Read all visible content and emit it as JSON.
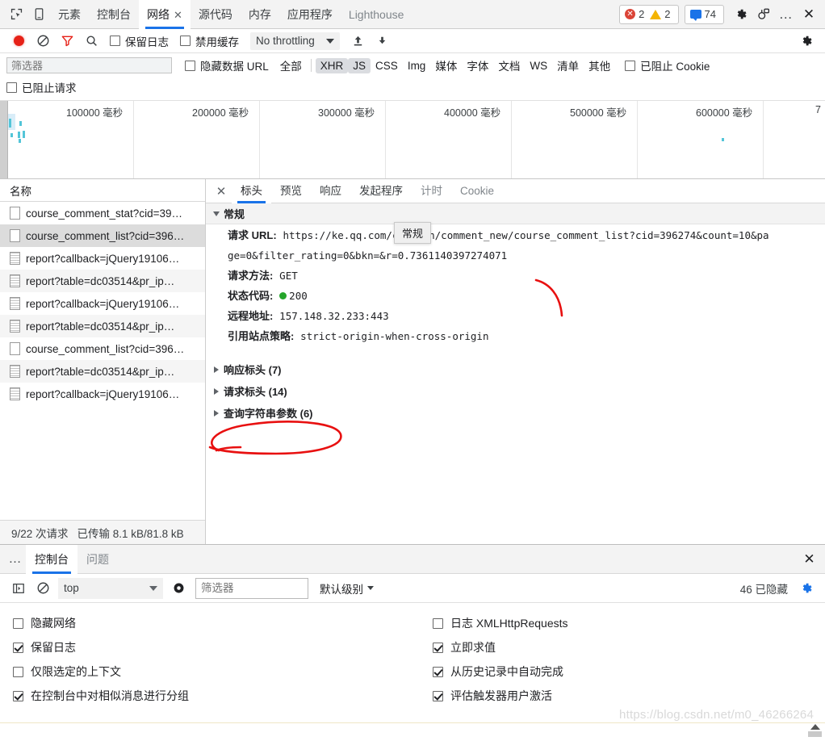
{
  "topbar": {
    "icons": [
      {
        "name": "inspect-element-icon"
      },
      {
        "name": "device-toolbar-icon"
      }
    ],
    "tabs": [
      {
        "label": "元素",
        "state": "normal"
      },
      {
        "label": "控制台",
        "state": "normal"
      },
      {
        "label": "网络",
        "state": "selected",
        "close": "✕"
      },
      {
        "label": "源代码",
        "state": "normal"
      },
      {
        "label": "内存",
        "state": "normal"
      },
      {
        "label": "应用程序",
        "state": "normal"
      },
      {
        "label": "Lighthouse",
        "state": "dim"
      }
    ],
    "errors": "2",
    "warnings": "2",
    "messages": "74",
    "settings_icon": "gear-icon",
    "customize_icon": "devices-icon",
    "more_icon": "…",
    "close_icon": "✕"
  },
  "network_toolbar": {
    "record_title": "record-button",
    "clear_title": "clear-button",
    "filter_title": "filter-button",
    "search_title": "search-button",
    "preserve_log": {
      "label": "保留日志",
      "checked": false
    },
    "disable_cache": {
      "label": "禁用缓存",
      "checked": false
    },
    "throttling": "No throttling",
    "import_title": "import-har-icon",
    "export_title": "export-har-icon",
    "settings_title": "network-settings-gear"
  },
  "filter_bar": {
    "placeholder": "筛选器",
    "hide_data_urls": {
      "label": "隐藏数据 URL",
      "checked": false
    },
    "types": [
      {
        "label": "全部",
        "active": false
      },
      {
        "label": "XHR",
        "active": true
      },
      {
        "label": "JS",
        "active": true
      },
      {
        "label": "CSS",
        "active": false
      },
      {
        "label": "Img",
        "active": false
      },
      {
        "label": "媒体",
        "active": false
      },
      {
        "label": "字体",
        "active": false
      },
      {
        "label": "文档",
        "active": false
      },
      {
        "label": "WS",
        "active": false
      },
      {
        "label": "清单",
        "active": false
      },
      {
        "label": "其他",
        "active": false
      }
    ],
    "blocked_cookies": {
      "label": "已阻止 Cookie",
      "checked": false
    },
    "blocked_requests": {
      "label": "已阻止请求",
      "checked": false
    }
  },
  "overview": {
    "ticks": [
      "100000 毫秒",
      "200000 毫秒",
      "300000 毫秒",
      "400000 毫秒",
      "500000 毫秒",
      "600000 毫秒",
      "7"
    ]
  },
  "requests": {
    "column_header": "名称",
    "rows": [
      {
        "name": "course_comment_stat?cid=39…",
        "icon": "xhr-icon",
        "selected": false
      },
      {
        "name": "course_comment_list?cid=396…",
        "icon": "xhr-icon",
        "selected": true
      },
      {
        "name": "report?callback=jQuery19106…",
        "icon": "script-icon",
        "selected": false
      },
      {
        "name": "report?table=dc03514&pr_ip…",
        "icon": "script-icon",
        "selected": false
      },
      {
        "name": "report?callback=jQuery19106…",
        "icon": "script-icon",
        "selected": false
      },
      {
        "name": "report?table=dc03514&pr_ip…",
        "icon": "script-icon",
        "selected": false
      },
      {
        "name": "course_comment_list?cid=396…",
        "icon": "xhr-icon",
        "selected": false
      },
      {
        "name": "report?table=dc03514&pr_ip…",
        "icon": "script-icon",
        "selected": false
      },
      {
        "name": "report?callback=jQuery19106…",
        "icon": "script-icon",
        "selected": false
      }
    ],
    "summary_requests": "9/22 次请求",
    "summary_transferred": "已传输 8.1 kB/81.8 kB"
  },
  "details": {
    "tabs": [
      {
        "label": "标头",
        "state": "selected"
      },
      {
        "label": "预览",
        "state": "normal"
      },
      {
        "label": "响应",
        "state": "normal"
      },
      {
        "label": "发起程序",
        "state": "normal"
      },
      {
        "label": "计时",
        "state": "dim"
      },
      {
        "label": "Cookie",
        "state": "dim"
      }
    ],
    "general_section": "常规",
    "tooltip": "常规",
    "fields": [
      {
        "key": "请求 URL:",
        "value": "https://ke.qq.com/cgi-bin/comment_new/course_comment_list?cid=396274&count=10&pa"
      },
      {
        "key": "",
        "value": "ge=0&filter_rating=0&bkn=&r=0.7361140397274071"
      },
      {
        "key": "请求方法:",
        "value": "GET"
      },
      {
        "key": "状态代码:",
        "value": "200",
        "status_dot": true
      },
      {
        "key": "远程地址:",
        "value": "157.148.32.233:443"
      },
      {
        "key": "引用站点策略:",
        "value": "strict-origin-when-cross-origin"
      }
    ],
    "collapsed": [
      {
        "label": "响应标头 (7)"
      },
      {
        "label": "请求标头 (14)"
      },
      {
        "label": "查询字符串参数 (6)"
      }
    ]
  },
  "drawer": {
    "more_icon": "…",
    "tabs": [
      {
        "label": "控制台",
        "state": "selected"
      },
      {
        "label": "问题",
        "state": "dim"
      }
    ],
    "close_icon": "✕"
  },
  "console_toolbar": {
    "sidebar_icon": "console-sidebar-icon",
    "clear_icon": "clear-console-icon",
    "context": "top",
    "eye_icon": "live-expression-icon",
    "filter_placeholder": "筛选器",
    "level": "默认级别",
    "hidden_count": "46 已隐藏",
    "settings_icon": "console-settings-gear"
  },
  "console_settings": {
    "left": [
      {
        "label": "隐藏网络",
        "checked": false
      },
      {
        "label": "保留日志",
        "checked": true
      },
      {
        "label": "仅限选定的上下文",
        "checked": false
      },
      {
        "label": "在控制台中对相似消息进行分组",
        "checked": true
      }
    ],
    "right": [
      {
        "label": "日志 XMLHttpRequests",
        "checked": false
      },
      {
        "label": "立即求值",
        "checked": true
      },
      {
        "label": "从历史记录中自动完成",
        "checked": true
      },
      {
        "label": "评估触发器用户激活",
        "checked": true
      }
    ]
  },
  "watermark": "https://blog.csdn.net/m0_46266264",
  "colors": {
    "accent": "#1a73e8",
    "error": "#db4437",
    "warning": "#f4b400",
    "success": "#25a52b",
    "annotation": "#e81010",
    "timeline_tick": "#53c5d8"
  }
}
